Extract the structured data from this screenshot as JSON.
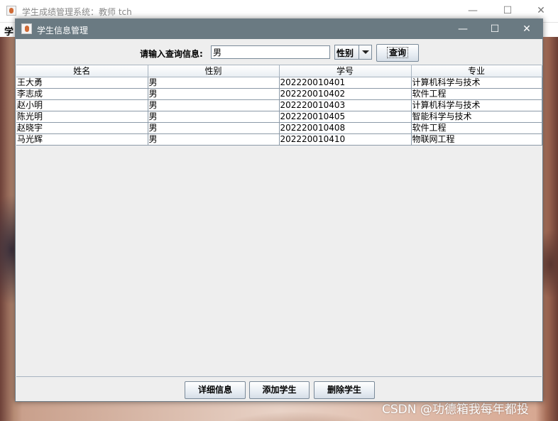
{
  "background_window": {
    "title": "学生成绩管理系统：教师 tch",
    "menu_char": "学",
    "controls": {
      "minimize": "—",
      "maximize": "☐",
      "close": "✕"
    }
  },
  "watermark": "CSDN @功德箱我每年都投",
  "dialog": {
    "title": "学生信息管理",
    "controls": {
      "minimize": "—",
      "maximize": "☐",
      "close": "✕"
    },
    "query": {
      "label": "请输入查询信息:",
      "input_value": "男",
      "select_value": "性别",
      "button_label": "查询"
    },
    "table": {
      "columns": [
        "姓名",
        "性别",
        "学号",
        "专业"
      ],
      "rows": [
        [
          "王大勇",
          "男",
          "202220010401",
          "计算机科学与技术"
        ],
        [
          "李志成",
          "男",
          "202220010402",
          "软件工程"
        ],
        [
          "赵小明",
          "男",
          "202220010403",
          "计算机科学与技术"
        ],
        [
          "陈光明",
          "男",
          "202220010405",
          "智能科学与技术"
        ],
        [
          "赵晓宇",
          "男",
          "202220010408",
          "软件工程"
        ],
        [
          "马光辉",
          "男",
          "202220010410",
          "物联网工程"
        ]
      ]
    },
    "buttons": {
      "detail": "详细信息",
      "add": "添加学生",
      "delete": "删除学生"
    }
  }
}
